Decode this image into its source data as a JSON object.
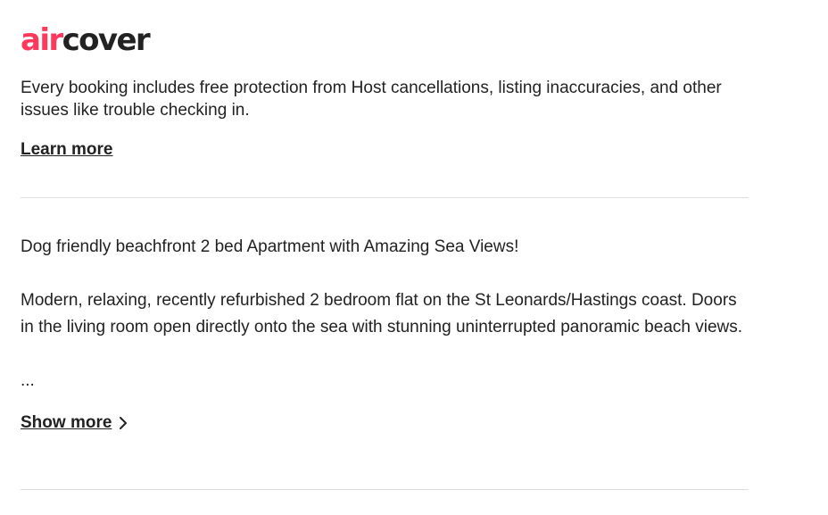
{
  "aircover": {
    "logo_air": "air",
    "logo_cover": "cover",
    "description": "Every booking includes free protection from Host cancellations, listing inaccuracies, and other issues like trouble checking in.",
    "learn_more_label": "Learn more"
  },
  "listing_description": {
    "headline": "Dog friendly beachfront 2 bed Apartment with Amazing Sea Views!",
    "body": "Modern, relaxing, recently refurbished 2 bedroom flat on the St Leonards/Hastings coast. Doors in the living room open directly onto the sea with stunning uninterrupted panoramic beach views.",
    "ellipsis": "...",
    "show_more_label": "Show more",
    "show_more_icon": "chevron-right-icon"
  },
  "colors": {
    "brand": "#ff385c",
    "text": "#222222",
    "divider": "#dddddd"
  }
}
